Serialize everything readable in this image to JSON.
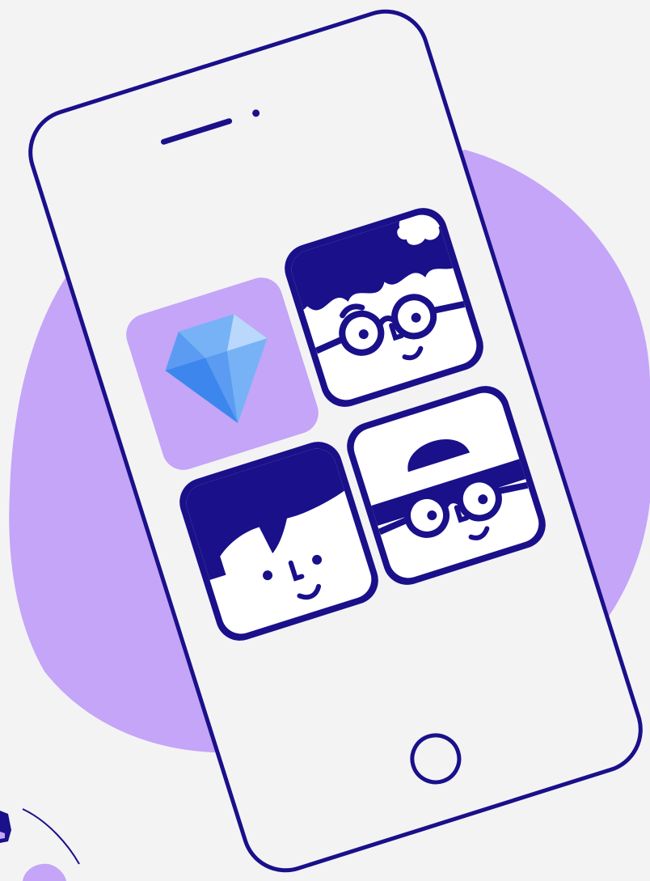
{
  "illustration": {
    "subject": "phone-app-grid",
    "colors": {
      "background": "#f3f3f4",
      "blob": "#c4a5f7",
      "outline": "#1a108a",
      "phone_fill": "#f3f3f4",
      "tile_white": "#ffffff",
      "diamond_tile": "#c4a5f7",
      "diamond_light": "#b9d8fb",
      "diamond_mid": "#77b2f6",
      "diamond_dark": "#3d86ee",
      "diamond_deep": "#5b9cf2",
      "cloud": "#ffffff"
    },
    "icons": [
      "phone-icon",
      "speaker-slot-icon",
      "camera-dot-icon",
      "home-button-icon",
      "diamond-app-icon",
      "avatar-curly-glasses-icon",
      "avatar-bowl-cut-icon",
      "avatar-cap-glasses-icon"
    ]
  }
}
